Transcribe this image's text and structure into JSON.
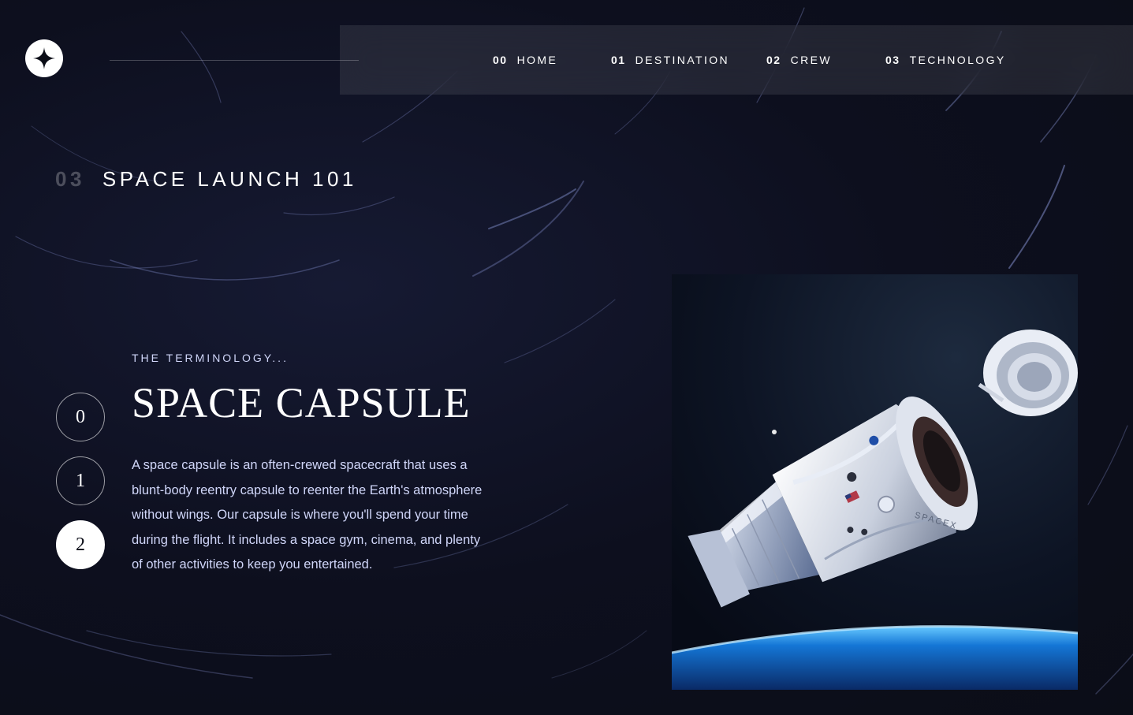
{
  "header": {
    "logo_icon": "star-logo-icon",
    "nav": [
      {
        "num": "00",
        "label": "HOME"
      },
      {
        "num": "01",
        "label": "DESTINATION"
      },
      {
        "num": "02",
        "label": "CREW"
      },
      {
        "num": "03",
        "label": "TECHNOLOGY"
      }
    ],
    "active_nav": "TECHNOLOGY"
  },
  "page": {
    "section_num": "03",
    "section_title": "SPACE LAUNCH 101"
  },
  "technology": {
    "selector": [
      "0",
      "1",
      "2"
    ],
    "selected": "2",
    "subheading": "THE TERMINOLOGY...",
    "title": "SPACE CAPSULE",
    "description": "A space capsule is an often-crewed spacecraft that uses a blunt-body reentry capsule to reenter the Earth's atmosphere without wings. Our capsule is where you'll spend your time during the flight. It includes a space gym, cinema, and plenty of other activities to keep you entertained.",
    "image_icon": "space-capsule-image"
  },
  "colors": {
    "background": "#0b0d17",
    "accent": "#d0d6f9",
    "white": "#ffffff"
  }
}
